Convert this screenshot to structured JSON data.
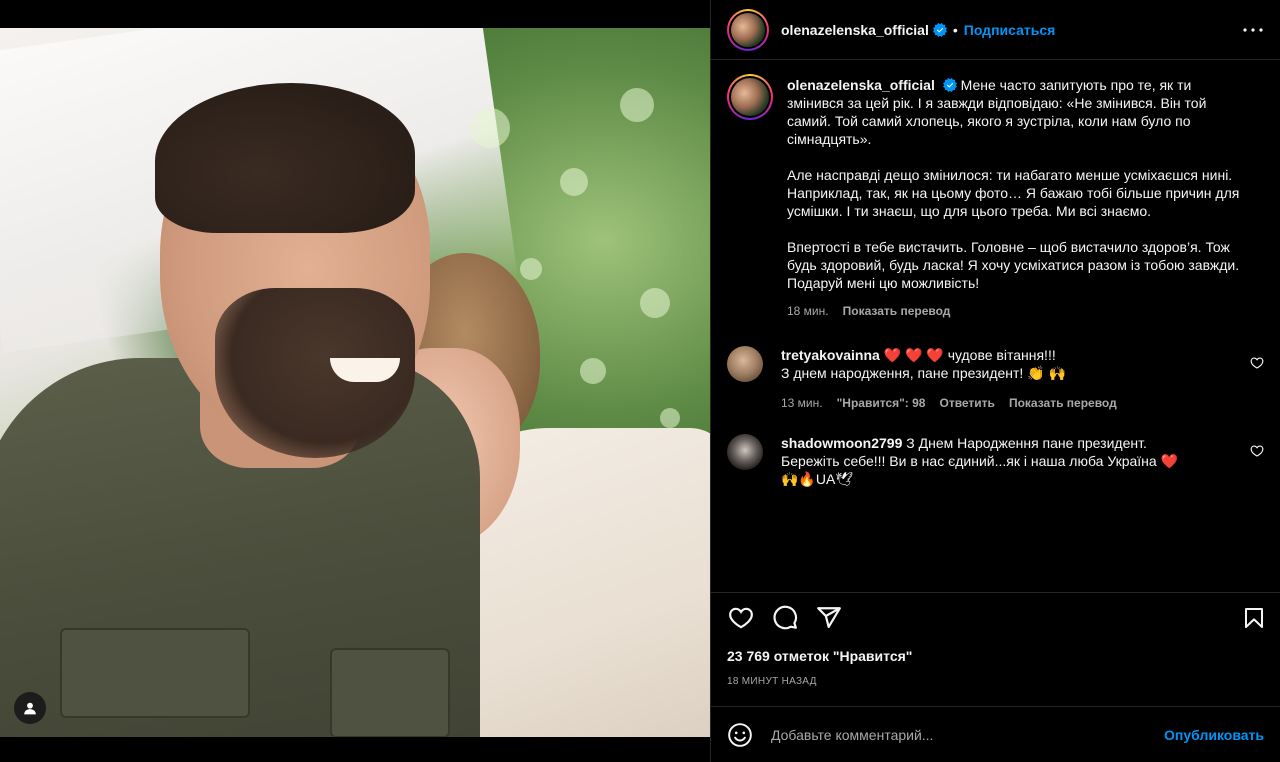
{
  "author": {
    "username": "olenazelenska_official",
    "follow_label": "Подписаться",
    "separator": "•"
  },
  "caption": {
    "username": "olenazelenska_official",
    "paragraphs": [
      "Мене часто запитують про те, як ти змінився за цей рік. І я завжди відповідаю: «Не змінився. Він той самий. Той самий хлопець, якого я зустріла, коли нам було по сімнадцять».",
      "Але насправді дещо змінилося: ти набагато менше усміхаєшся нині. Наприклад, так, як на цьому фото… Я бажаю тобі більше причин для усмішки. І ти знаєш, що для цього треба. Ми всі знаємо.",
      "Впертості в тебе вистачить. Головне – щоб вистачило здоров’я. Тож будь здоровий, будь ласка! Я хочу усміхатися разом із тобою завжди. Подаруй мені цю можливість!"
    ],
    "time": "18 мин.",
    "translate_label": "Показать перевод"
  },
  "comments": [
    {
      "username": "tretyakovainna",
      "hearts": "❤️ ❤️ ❤️",
      "text_line1": "чудове вітання!!!",
      "text_line2": "З днем народження, пане президент! 👏 🙌",
      "time": "13 мин.",
      "likes": "\"Нравится\": 98",
      "reply_label": "Ответить",
      "translate_label": "Показать перевод"
    },
    {
      "username": "shadowmoon2799",
      "text_line1": "З Днем Народження пане президент.",
      "text_line2": "Бережіть себе!!! Ви в нас єдиний...як і наша люба Україна",
      "text_heart": "❤️",
      "text_line3": "🙌🔥UA🕊"
    }
  ],
  "likes_label": "23 769 отметок \"Нравится\"",
  "time_ago": "18 МИНУТ НАЗАД",
  "comment_box": {
    "placeholder": "Добавьте комментарий...",
    "publish_label": "Опубликовать"
  },
  "colors": {
    "accent": "#0095f6",
    "background": "#000000",
    "heart_red": "#ed4956",
    "muted": "#a8a8a8"
  }
}
